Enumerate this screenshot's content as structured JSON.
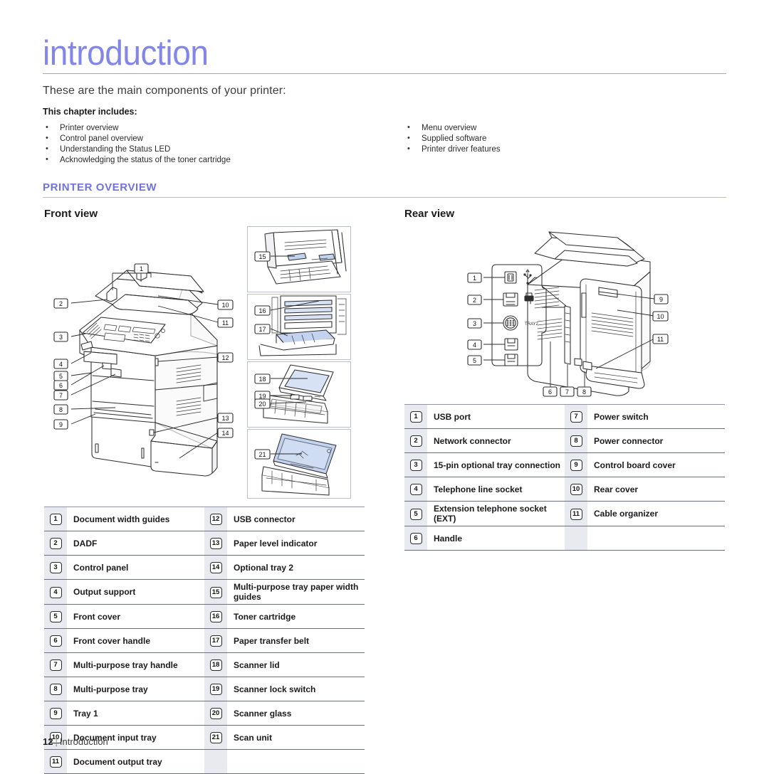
{
  "document": {
    "chapter_title": "introduction",
    "lead": "These are the main components of your printer:",
    "includes_label": "This chapter includes:",
    "includes_left": [
      "Printer overview",
      "Control panel overview",
      "Understanding the Status LED",
      "Acknowledging the status of the toner cartridge"
    ],
    "includes_right": [
      "Menu overview",
      "Supplied software",
      "Printer driver features"
    ],
    "section_heading": "PRINTER OVERVIEW",
    "front_view_heading": "Front view",
    "rear_view_heading": "Rear view",
    "footer": {
      "page_number": "12",
      "separator": "|",
      "chapter": "Introduction"
    },
    "accent_color": "#6f72e0",
    "title_color": "#8186e8",
    "number_cell_bg": "#e9eaf0"
  },
  "front_view": {
    "callouts_main": [
      "1",
      "2",
      "3",
      "4",
      "5",
      "6",
      "7",
      "8",
      "9",
      "10",
      "11",
      "12",
      "13",
      "14"
    ],
    "callouts_panel_1": [
      "15"
    ],
    "callouts_panel_2": [
      "16",
      "17"
    ],
    "callouts_panel_3": [
      "18",
      "19",
      "20"
    ],
    "callouts_panel_4": [
      "21"
    ],
    "table": [
      {
        "n_left": "1",
        "label_left": "Document width guides",
        "n_right": "12",
        "label_right": "USB connector"
      },
      {
        "n_left": "2",
        "label_left": "DADF",
        "n_right": "13",
        "label_right": "Paper level indicator"
      },
      {
        "n_left": "3",
        "label_left": "Control panel",
        "n_right": "14",
        "label_right": "Optional tray 2"
      },
      {
        "n_left": "4",
        "label_left": "Output support",
        "n_right": "15",
        "label_right": "Multi-purpose tray paper width guides"
      },
      {
        "n_left": "5",
        "label_left": "Front cover",
        "n_right": "16",
        "label_right": "Toner cartridge"
      },
      {
        "n_left": "6",
        "label_left": "Front cover handle",
        "n_right": "17",
        "label_right": "Paper transfer belt"
      },
      {
        "n_left": "7",
        "label_left": "Multi-purpose tray handle",
        "n_right": "18",
        "label_right": "Scanner lid"
      },
      {
        "n_left": "8",
        "label_left": "Multi-purpose tray",
        "n_right": "19",
        "label_right": "Scanner lock switch"
      },
      {
        "n_left": "9",
        "label_left": "Tray 1",
        "n_right": "20",
        "label_right": "Scanner glass"
      },
      {
        "n_left": "10",
        "label_left": "Document input tray",
        "n_right": "21",
        "label_right": "Scan unit"
      },
      {
        "n_left": "11",
        "label_left": "Document output tray",
        "n_right": "",
        "label_right": ""
      }
    ]
  },
  "rear_view": {
    "callouts": [
      "1",
      "2",
      "3",
      "4",
      "5",
      "6",
      "7",
      "8",
      "9",
      "10",
      "11"
    ],
    "port_label": "TRAY2",
    "table": [
      {
        "n_left": "1",
        "label_left": "USB port",
        "n_right": "7",
        "label_right": "Power switch"
      },
      {
        "n_left": "2",
        "label_left": "Network connector",
        "n_right": "8",
        "label_right": "Power connector"
      },
      {
        "n_left": "3",
        "label_left": "15-pin optional tray connection",
        "n_right": "9",
        "label_right": "Control board cover"
      },
      {
        "n_left": "4",
        "label_left": "Telephone line socket",
        "n_right": "10",
        "label_right": "Rear cover"
      },
      {
        "n_left": "5",
        "label_left": "Extension telephone socket (EXT)",
        "n_right": "11",
        "label_right": "Cable organizer"
      },
      {
        "n_left": "6",
        "label_left": "Handle",
        "n_right": "",
        "label_right": ""
      }
    ]
  }
}
